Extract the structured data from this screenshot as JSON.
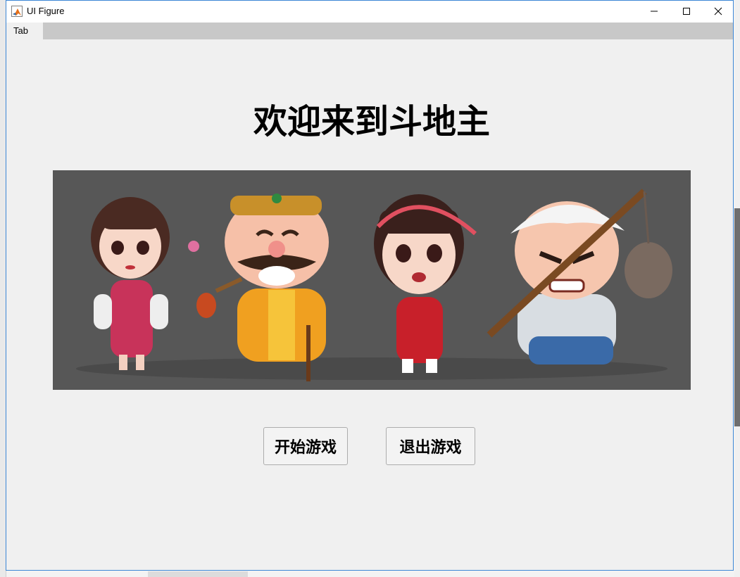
{
  "window": {
    "title": "UI Figure",
    "icon": "matlab-logo-icon",
    "controls": [
      "minimize-icon",
      "maximize-icon",
      "close-icon"
    ]
  },
  "tabs": [
    {
      "label": "Tab",
      "selected": true
    }
  ],
  "main": {
    "heading": "欢迎来到斗地主",
    "banner": {
      "image": "doudizhu-characters-artwork",
      "background": "#575757"
    },
    "buttons": {
      "start_label": "开始游戏",
      "quit_label": "退出游戏"
    }
  },
  "colors": {
    "window_border": "#3c87d6",
    "tab_strip": "#c8c8c8",
    "panel": "#f0f0f0"
  }
}
